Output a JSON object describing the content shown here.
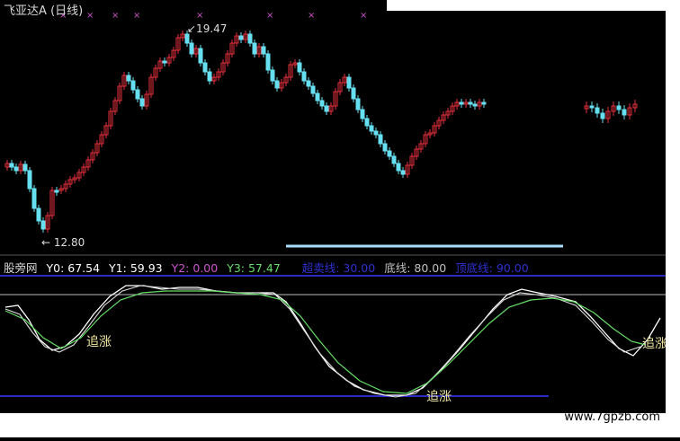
{
  "header": {
    "stock_name": "飞亚达",
    "stock_suffix": "A",
    "period": "(日线)",
    "max_price_label": "19.47",
    "min_price_label": "12.80"
  },
  "indicator": {
    "name": "股旁网",
    "y0": "Y0: 67.54",
    "y1": "Y1: 59.93",
    "y2": "Y2: 0.00",
    "y3": "Y3: 57.47",
    "oversell": "超卖线: 30.00",
    "bottom": "底线: 80.00",
    "overbuy": "顶底线: 90.00",
    "signal_label": "追涨",
    "colors": {
      "y0": "#ffffff",
      "y1": "#ffffff",
      "y2": "#cc55cc",
      "y3": "#66dd66",
      "ref": "#2a2ac0"
    }
  },
  "watermark": "www.7gpzb.com",
  "colors": {
    "up": "#e0303a",
    "down": "#66e0f0",
    "background": "#000000",
    "highlight_bar": "#aaddff"
  }
}
